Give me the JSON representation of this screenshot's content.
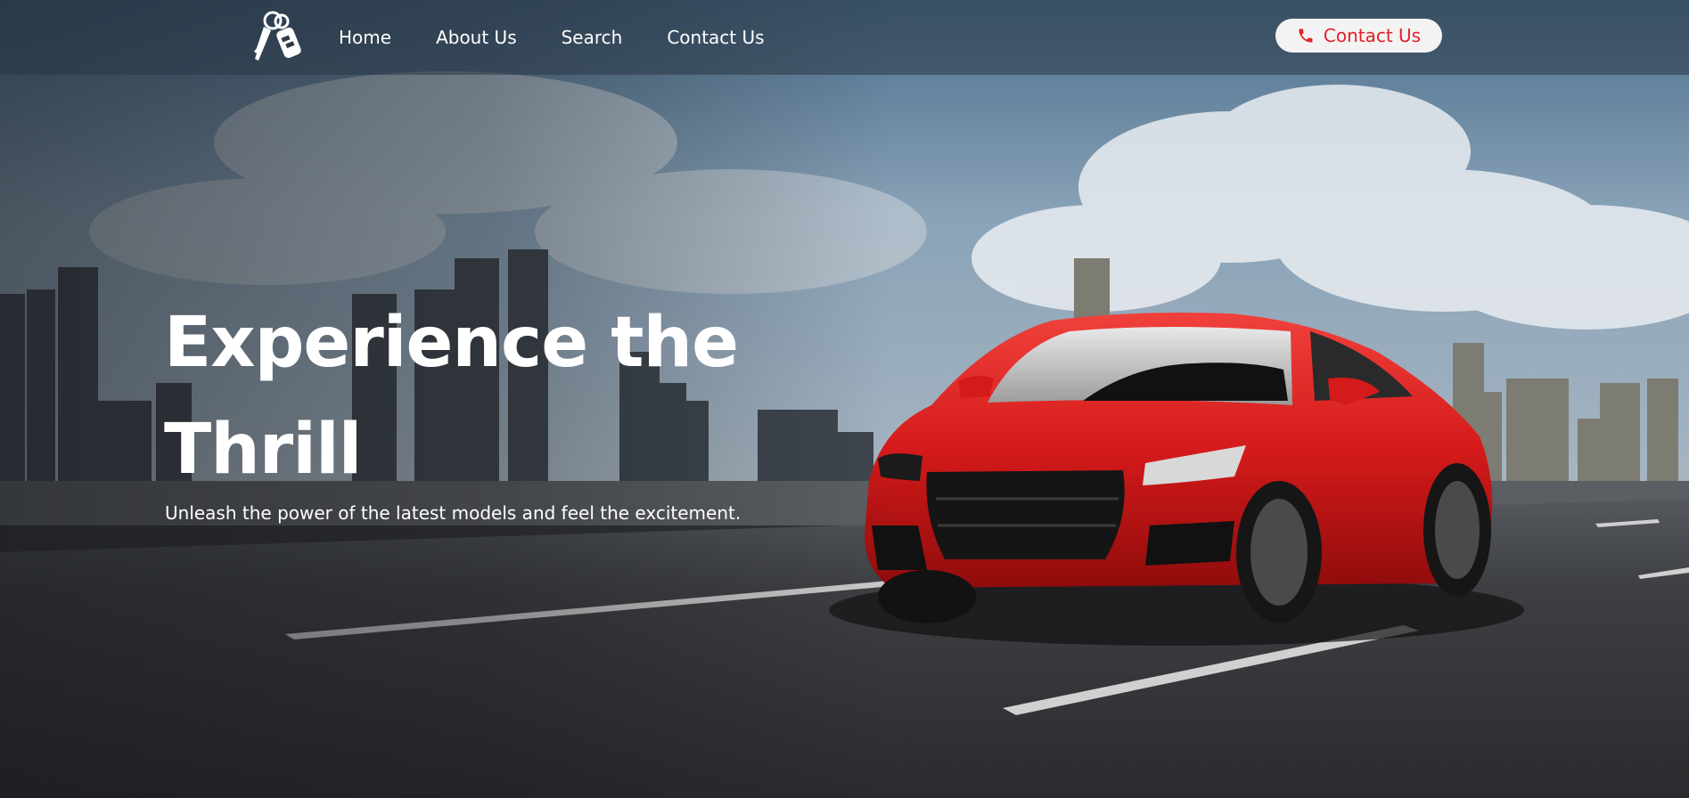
{
  "nav": {
    "logo": "car-keys-logo",
    "links": [
      {
        "label": "Home"
      },
      {
        "label": "About Us"
      },
      {
        "label": "Search"
      },
      {
        "label": "Contact Us"
      }
    ],
    "cta": {
      "label": "Contact Us",
      "icon": "phone-icon",
      "color": "#e0202a"
    }
  },
  "hero": {
    "title_line1": "Experience the",
    "title_line2": "Thrill",
    "subtitle": "Unleash the power of the latest models and feel the excitement.",
    "car_color": "#d41a1a"
  }
}
